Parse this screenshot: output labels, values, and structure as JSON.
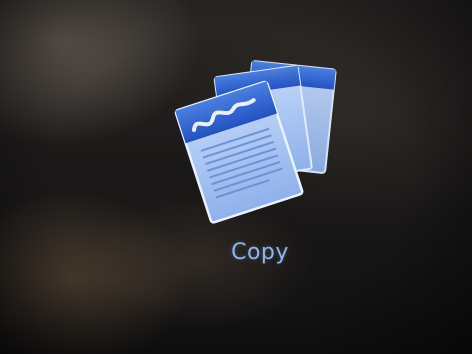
{
  "home": {
    "copy_app": {
      "label": "Copy",
      "icon": "copy-documents-icon"
    }
  },
  "colors": {
    "label_text": "#8fb4ee",
    "icon_header": "#2f5fcf",
    "icon_page": "#a9c6f5"
  }
}
